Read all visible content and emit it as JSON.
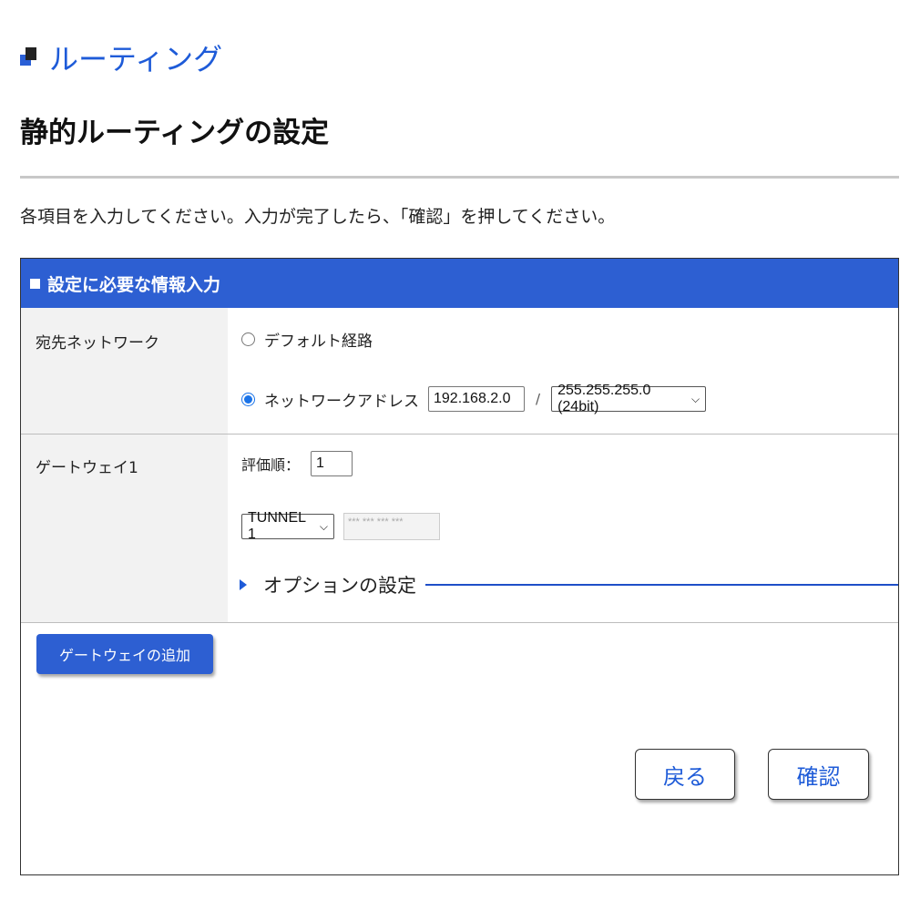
{
  "section": {
    "title": "ルーティング",
    "icon": "section-squares-icon"
  },
  "page": {
    "title": "静的ルーティングの設定",
    "instructions": "各項目を入力してください。入力が完了したら、「確認」を押してください。"
  },
  "panel": {
    "header": "設定に必要な情報入力",
    "destination": {
      "label": "宛先ネットワーク",
      "options": [
        {
          "label": "デフォルト経路",
          "checked": false
        },
        {
          "label": "ネットワークアドレス",
          "checked": true
        }
      ],
      "ip_value": "192.168.2.0",
      "separator": "/",
      "mask_value": "255.255.255.0 (24bit)"
    },
    "gateway": {
      "label": "ゲートウェイ1",
      "priority_label": "評価順：",
      "priority_value": "1",
      "interface_value": "TUNNEL 1",
      "address_placeholder": "*** *** *** ***",
      "options_label": "オプションの設定"
    },
    "add_gateway_label": "ゲートウェイの追加",
    "back_label": "戻る",
    "confirm_label": "確認"
  },
  "colors": {
    "accent": "#2d5fd2",
    "title_blue": "#1e5bd8",
    "radio_blue": "#1a73e8"
  }
}
